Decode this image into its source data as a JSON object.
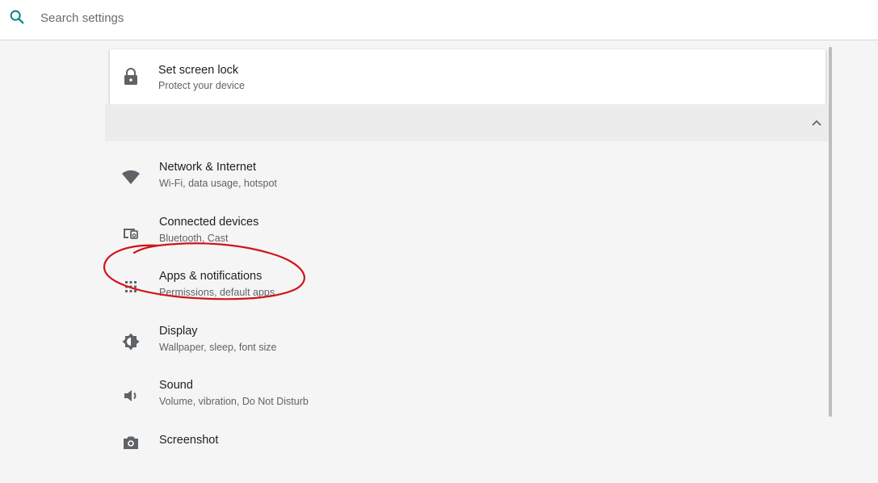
{
  "search": {
    "placeholder": "Search settings",
    "icon": "search-icon",
    "accent_color": "#00897b"
  },
  "suggestion": {
    "title": "Set screen lock",
    "subtitle": "Protect your device",
    "icon": "lock-icon"
  },
  "collapse": {
    "icon": "chevron-up-icon"
  },
  "settings": [
    {
      "title": "Network & Internet",
      "subtitle": "Wi-Fi, data usage, hotspot",
      "icon": "wifi-icon"
    },
    {
      "title": "Connected devices",
      "subtitle": "Bluetooth, Cast",
      "icon": "devices-icon"
    },
    {
      "title": "Apps & notifications",
      "subtitle": "Permissions, default apps",
      "icon": "apps-grid-icon"
    },
    {
      "title": "Display",
      "subtitle": "Wallpaper, sleep, font size",
      "icon": "brightness-icon"
    },
    {
      "title": "Sound",
      "subtitle": "Volume, vibration, Do Not Disturb",
      "icon": "volume-icon"
    },
    {
      "title": "Screenshot",
      "subtitle": "",
      "icon": "camera-icon"
    }
  ],
  "annotation": {
    "highlight_color": "#d0141a",
    "target": "Apps & notifications"
  }
}
